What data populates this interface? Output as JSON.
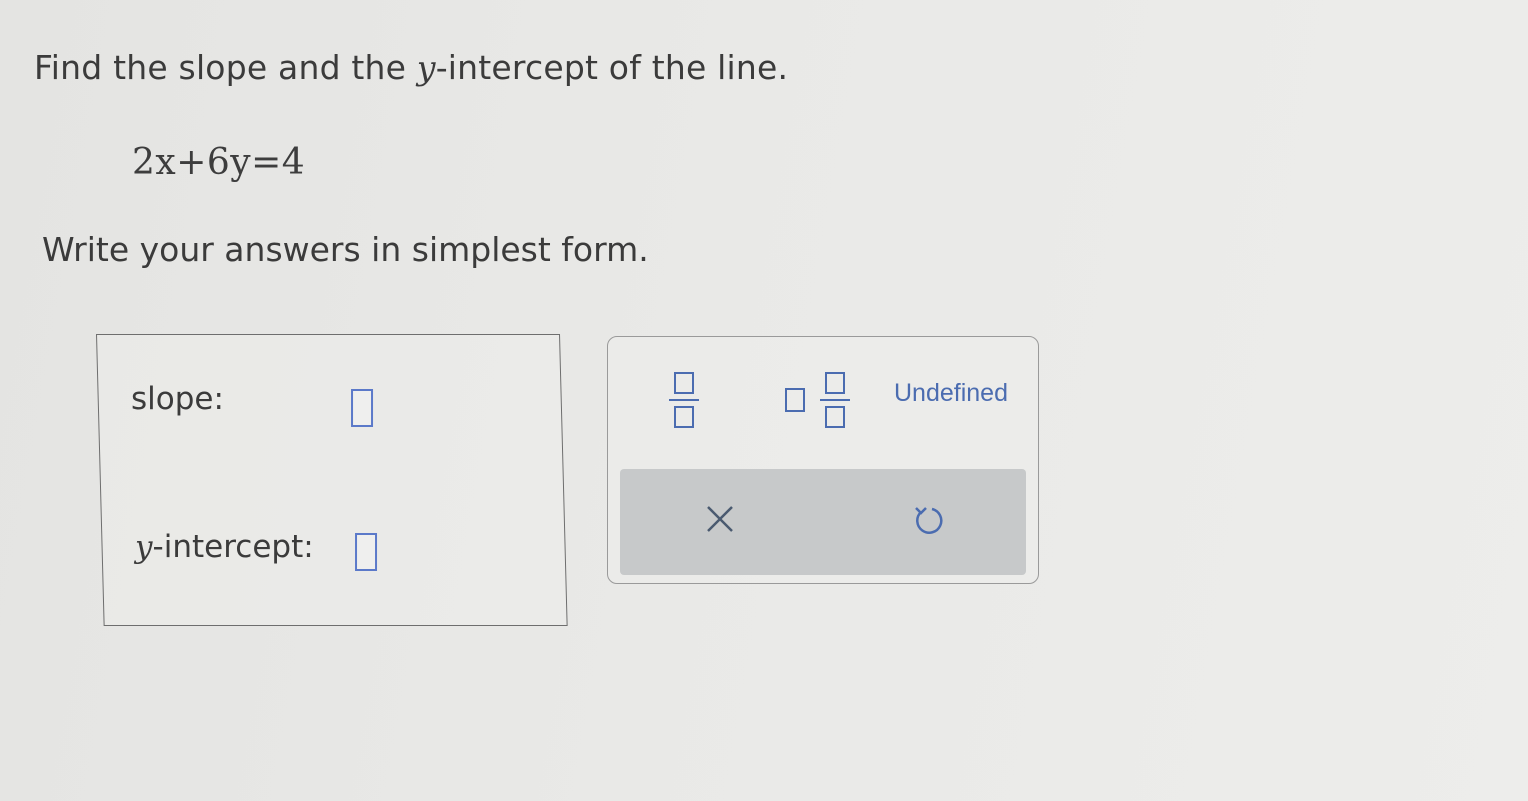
{
  "question": {
    "prefix": "Find the slope and the ",
    "variable": "y",
    "suffix": "-intercept of the line."
  },
  "equation": "2x+6y=4",
  "instruction": "Write your answers in simplest form.",
  "answers": {
    "slope_label": "slope:",
    "yint_var": "y",
    "yint_label": "-intercept:",
    "slope_value": "",
    "yint_value": ""
  },
  "toolbar": {
    "fraction_icon": "fraction-icon",
    "mixed_number_icon": "mixed-number-icon",
    "undefined_label": "Undefined",
    "clear_icon": "close-icon",
    "undo_icon": "undo-icon"
  },
  "colors": {
    "input_border": "#5b79c9",
    "tool_accent": "#4b6cb0",
    "tool_row_bg": "#c7c9ca"
  }
}
